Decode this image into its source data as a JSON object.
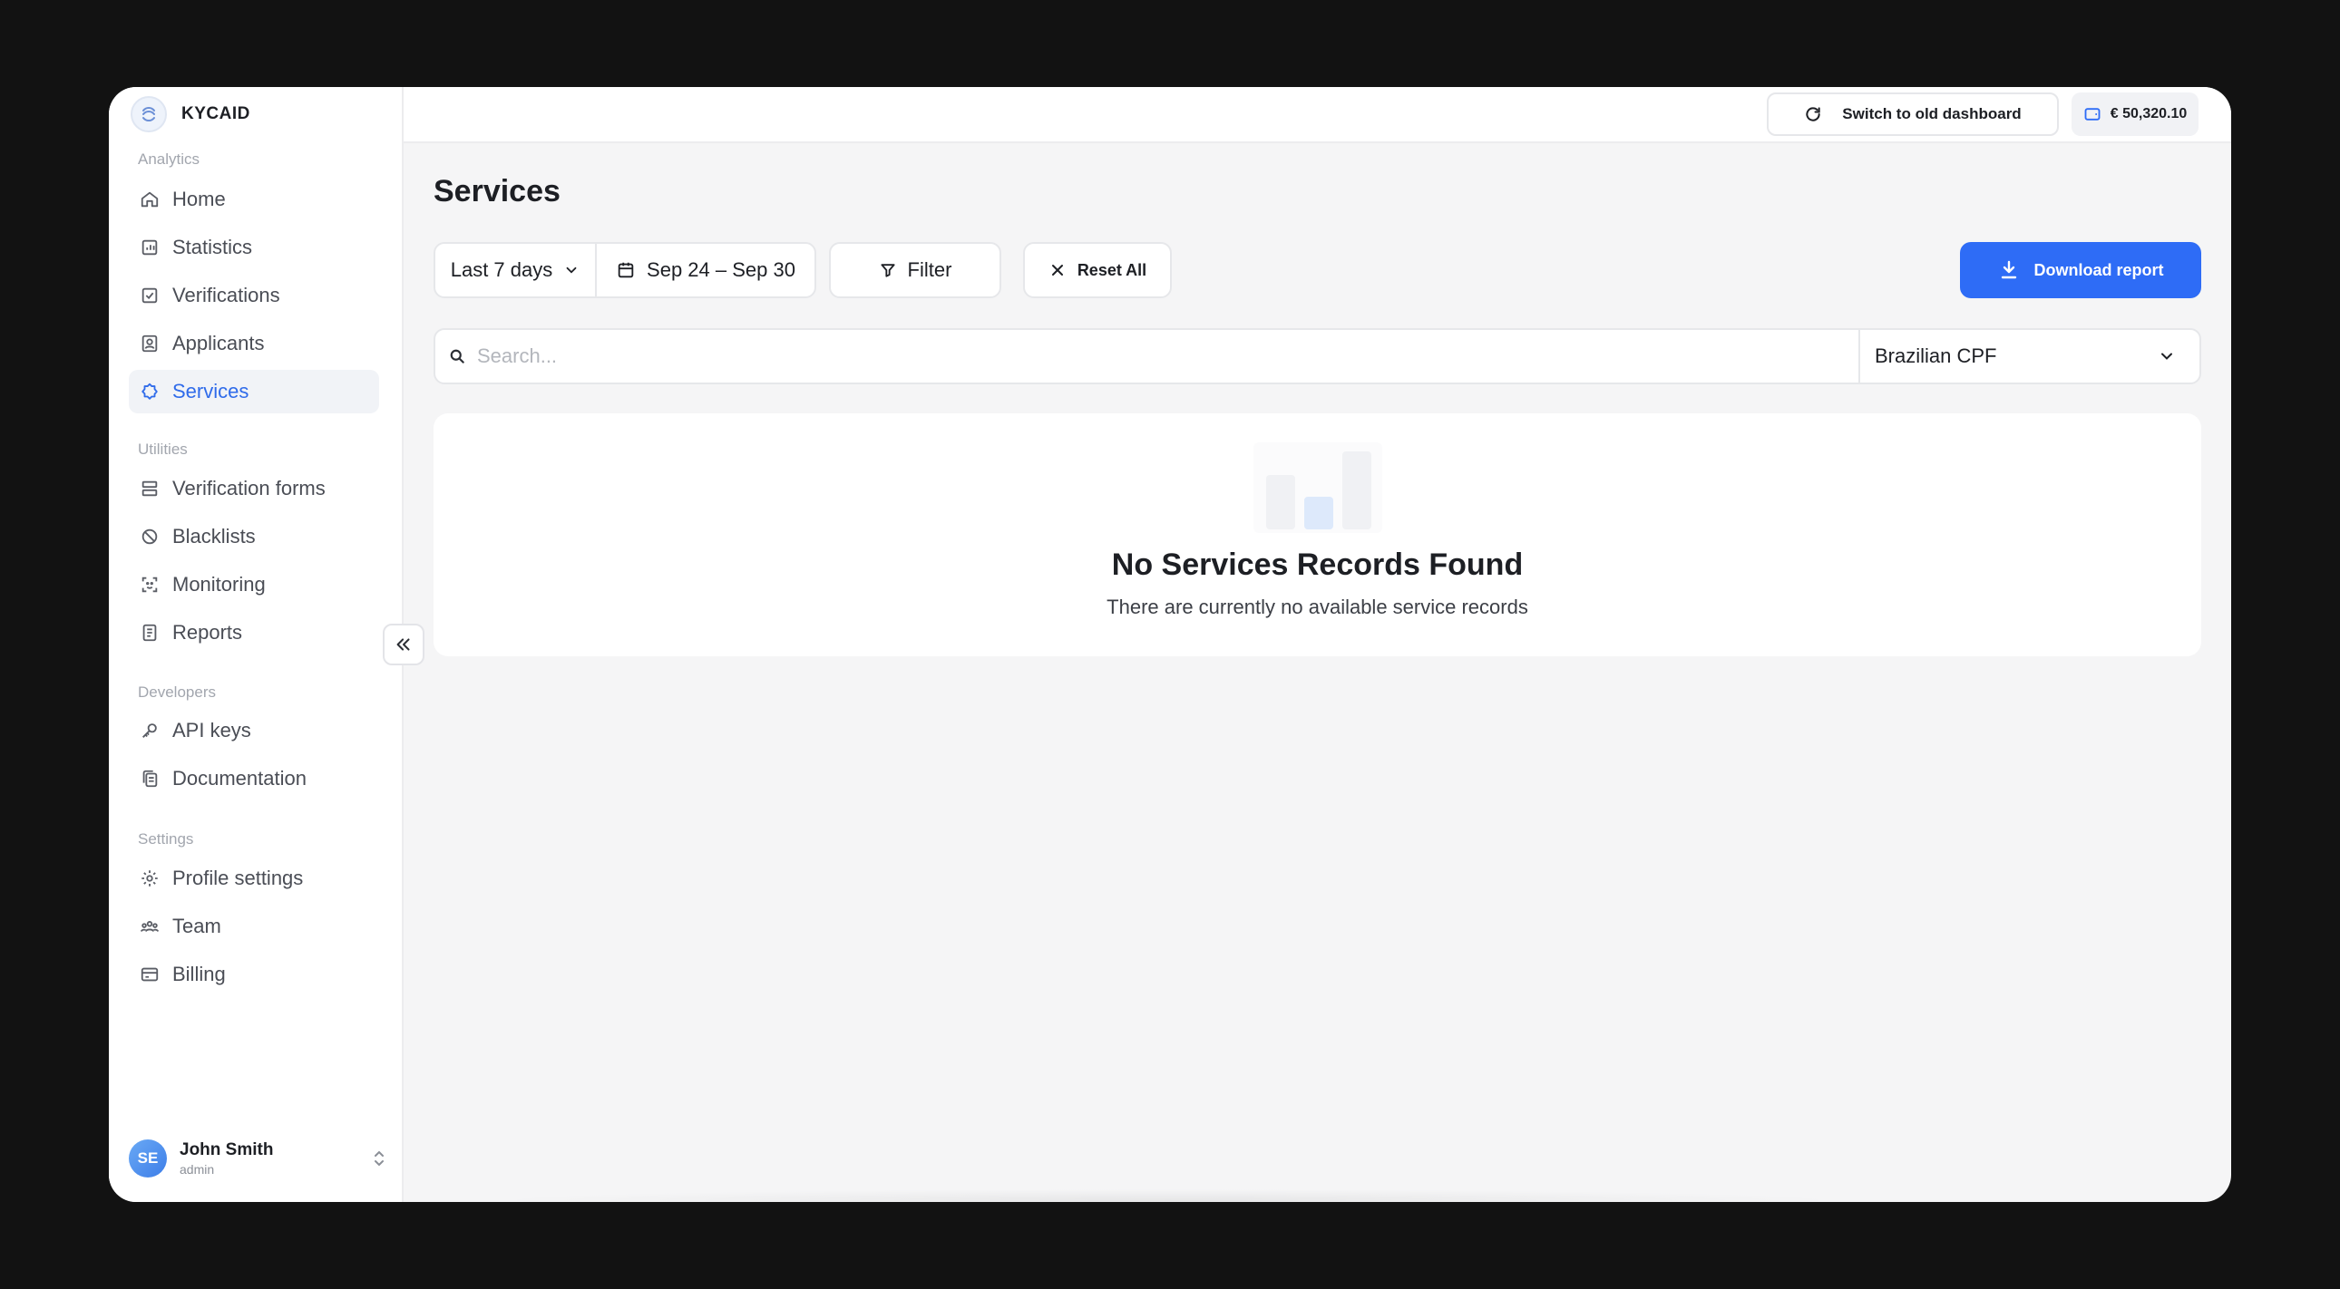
{
  "brand": {
    "name": "KYCAID"
  },
  "sidebar": {
    "sections": {
      "analytics": "Analytics",
      "utilities": "Utilities",
      "developers": "Developers",
      "settings": "Settings"
    },
    "items": {
      "home": "Home",
      "statistics": "Statistics",
      "verifications": "Verifications",
      "applicants": "Applicants",
      "services": "Services",
      "verification_forms": "Verification forms",
      "blacklists": "Blacklists",
      "monitoring": "Monitoring",
      "reports": "Reports",
      "api_keys": "API keys",
      "documentation": "Documentation",
      "profile_settings": "Profile settings",
      "team": "Team",
      "billing": "Billing"
    },
    "active_item": "services"
  },
  "user": {
    "initials": "SE",
    "name": "John Smith",
    "role": "admin"
  },
  "topbar": {
    "switch_label": "Switch to old dashboard",
    "balance": "€ 50,320.10"
  },
  "page": {
    "title": "Services"
  },
  "toolbar": {
    "range_label": "Last 7 days",
    "date_value": "Sep 24 – Sep 30",
    "filter_label": "Filter",
    "reset_label": "Reset All",
    "download_label": "Download report"
  },
  "search": {
    "placeholder": "Search...",
    "value": "",
    "service_selected": "Brazilian CPF"
  },
  "empty_state": {
    "title": "No Services Records Found",
    "subtitle": "There are currently no available service records"
  },
  "colors": {
    "accent": "#2e6cf6",
    "active_text": "#2f6bea"
  }
}
